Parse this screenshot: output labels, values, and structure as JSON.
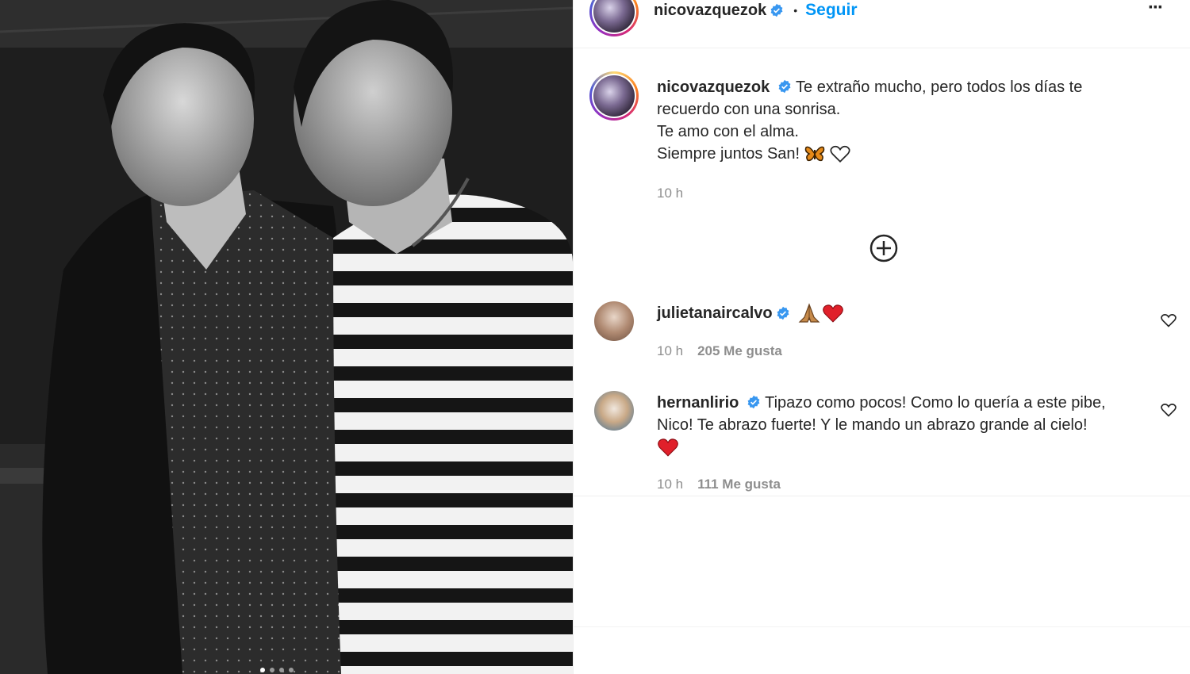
{
  "post": {
    "author": "nicovazquezok",
    "follow_label": "Seguir",
    "separator": "•",
    "more_label": "···"
  },
  "caption": {
    "author": "nicovazquezok",
    "line1": "Te extraño mucho, pero todos los días te",
    "line2": "recuerdo con una sonrisa.",
    "line3": "Te amo con el alma.",
    "line4": "Siempre juntos San!",
    "time": "10 h"
  },
  "comments": [
    {
      "user": "julietanaircalvo",
      "time": "10 h",
      "likes": "205 Me gusta"
    },
    {
      "user": "hernanlirio",
      "line1": "Tipazo como pocos! Como lo quería a este pibe,",
      "line2": "Nico! Te abrazo fuerte! Y le mando un abrazo grande al cielo!",
      "time": "10 h",
      "likes": "111 Me gusta"
    }
  ],
  "carousel": {
    "count": 4,
    "active": 1
  },
  "colors": {
    "link": "#0095f6",
    "verified": "#3897f0",
    "heart": "#ed4956",
    "muted": "#8e8e8e"
  },
  "icons": [
    "verified-icon",
    "more-options-icon",
    "load-more-comments-icon",
    "butterfly-emoji",
    "heart-outline-icon",
    "pray-emoji",
    "red-heart-emoji"
  ]
}
